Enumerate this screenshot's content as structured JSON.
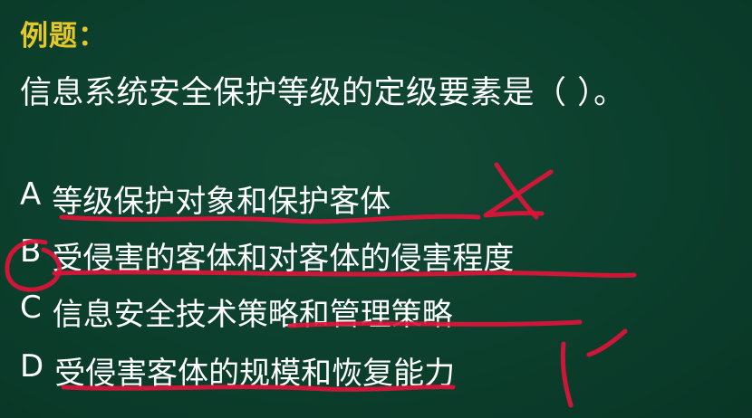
{
  "slide": {
    "label": "例题：",
    "question": "信息系统安全保护等级的定级要素是（  ）。",
    "options": [
      {
        "letter": "A",
        "text": "等级保护对象和保护客体"
      },
      {
        "letter": "B",
        "text": "受侵害的客体和对客体的侵害程度"
      },
      {
        "letter": "C",
        "text": "信息安全技术策略和管理策略"
      },
      {
        "letter": "D",
        "text": "受侵害客体的规模和恢复能力"
      }
    ]
  },
  "colors": {
    "board": "#0c3f2d",
    "label": "#e6c72a",
    "text": "#ffffff",
    "ink": "#e0143a"
  }
}
